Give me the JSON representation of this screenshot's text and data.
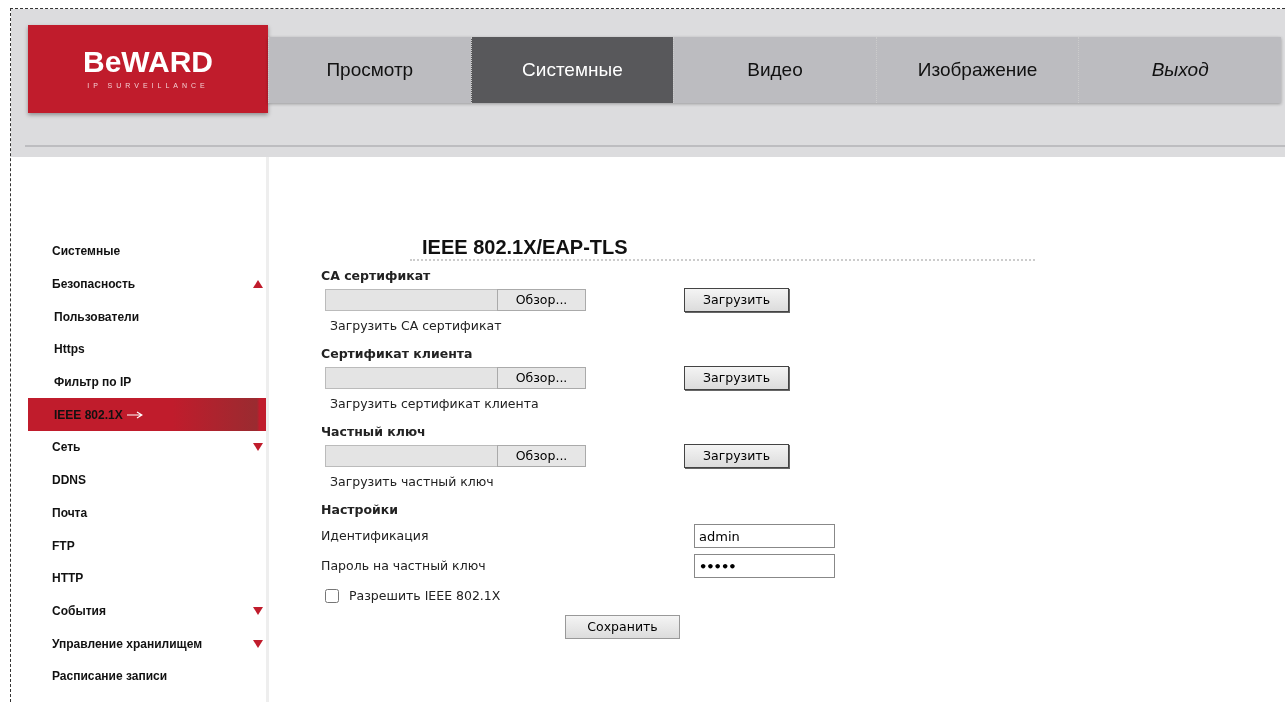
{
  "logo": {
    "brand": "BeWARD",
    "tagline": "IP SURVEILLANCE"
  },
  "tabs": [
    {
      "label": "Просмотр",
      "selected": false,
      "kind": "page"
    },
    {
      "label": "Системные",
      "selected": true,
      "kind": "page"
    },
    {
      "label": "Видео",
      "selected": false,
      "kind": "page"
    },
    {
      "label": "Изображение",
      "selected": false,
      "kind": "page"
    },
    {
      "label": "Выход",
      "selected": false,
      "kind": "logout"
    }
  ],
  "sidebar": {
    "items": [
      {
        "label": "Системные",
        "selected": false
      },
      {
        "label": "Безопасность",
        "selected": false,
        "expanded": true,
        "children": [
          {
            "label": "Пользователи",
            "selected": false
          },
          {
            "label": "Https",
            "selected": false
          },
          {
            "label": "Фильтр по IP",
            "selected": false
          },
          {
            "label": "IEEE 802.1X",
            "selected": true
          }
        ]
      },
      {
        "label": "Сеть",
        "selected": false,
        "expanded": false
      },
      {
        "label": "DDNS",
        "selected": false
      },
      {
        "label": "Почта",
        "selected": false
      },
      {
        "label": "FTP",
        "selected": false
      },
      {
        "label": "HTTP",
        "selected": false
      },
      {
        "label": "События",
        "selected": false,
        "expanded": false
      },
      {
        "label": "Управление хранилищем",
        "selected": false,
        "expanded": false
      },
      {
        "label": "Расписание записи",
        "selected": false
      }
    ]
  },
  "title": "IEEE 802.1X/EAP-TLS",
  "uploads": [
    {
      "heading": "CA сертификат",
      "browse": "Обзор...",
      "button": "Загрузить",
      "hint": "Загрузить CA сертификат"
    },
    {
      "heading": "Сертификат клиента",
      "browse": "Обзор...",
      "button": "Загрузить",
      "hint": "Загрузить сертификат клиента"
    },
    {
      "heading": "Частный ключ",
      "browse": "Обзор...",
      "button": "Загрузить",
      "hint": "Загрузить частный ключ"
    }
  ],
  "settings": {
    "heading": "Настройки",
    "fields": [
      {
        "label": "Идентификация",
        "value": "admin",
        "kind": "text"
      },
      {
        "label": "Пароль на частный ключ",
        "value": "•••••",
        "kind": "password"
      }
    ],
    "enable": {
      "label": "Разрешить IEEE 802.1X",
      "checked": false
    },
    "save": "Сохранить"
  }
}
